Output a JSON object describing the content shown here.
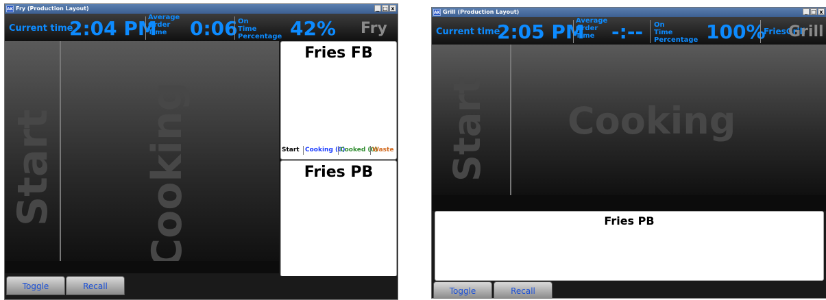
{
  "windows": {
    "fry": {
      "title": "Fry (Production Layout)",
      "app_icon": "AK",
      "controls": [
        "_",
        "□",
        "x"
      ],
      "header": {
        "current_time_label": "Current time",
        "current_time": "2:04 PM",
        "avg_order_label": [
          "Average",
          "Order",
          "Time"
        ],
        "avg_order_value": "0:06",
        "on_time_label": [
          "On",
          "Time",
          "Percentage"
        ],
        "on_time_value": "42%",
        "station": "Fry"
      },
      "columns": {
        "start": "Start",
        "cooking": "Cooking"
      },
      "cards": [
        {
          "name": "Fries FB",
          "legend": {
            "start": "Start",
            "cooking": "Cooking (0)",
            "cooked": "Cooked (0)",
            "waste": "Waste ("
          }
        },
        {
          "name": "Fries PB"
        }
      ],
      "footer": {
        "toggle": "Toggle",
        "recall": "Recall"
      }
    },
    "grill": {
      "title": "Grill (Production Layout)",
      "app_icon": "AK",
      "controls": [
        "_",
        "□",
        "x"
      ],
      "header": {
        "current_time_label": "Current time",
        "current_time": "2:05 PM",
        "avg_order_label": [
          "Average",
          "Order",
          "Time"
        ],
        "avg_order_value": "-:--",
        "on_time_label": [
          "On",
          "Time",
          "Percentage"
        ],
        "on_time_value": "100%",
        "station_overlap_left": "FriesGrill",
        "station": "Grill"
      },
      "columns": {
        "start": "Start",
        "cooking": "Cooking"
      },
      "cards": [
        {
          "name": "Fries PB"
        }
      ],
      "footer": {
        "toggle": "Toggle",
        "recall": "Recall"
      }
    }
  },
  "colors": {
    "header_text": "#0d8bff",
    "legend_start": "#000000",
    "legend_cooking": "#1a3cff",
    "legend_cooked": "#2e8b2e",
    "legend_waste": "#d2691e",
    "button_text": "#1a4fd6"
  }
}
